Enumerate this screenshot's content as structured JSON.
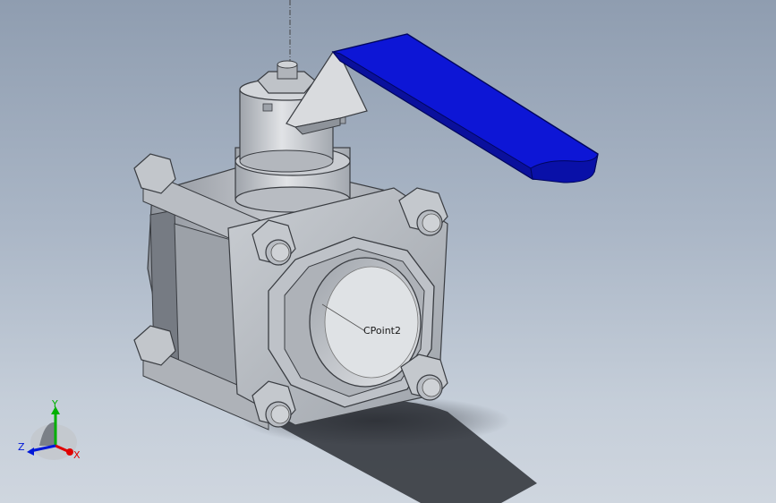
{
  "viewport": {
    "point_label": "CPoint2"
  },
  "triad": {
    "x_label": "X",
    "y_label": "Y",
    "z_label": "Z",
    "colors": {
      "x": "#e00000",
      "y": "#00b000",
      "z": "#0018d8"
    }
  },
  "model": {
    "handle_color": "#0d16d6",
    "body_color": "#b5b9c0"
  }
}
